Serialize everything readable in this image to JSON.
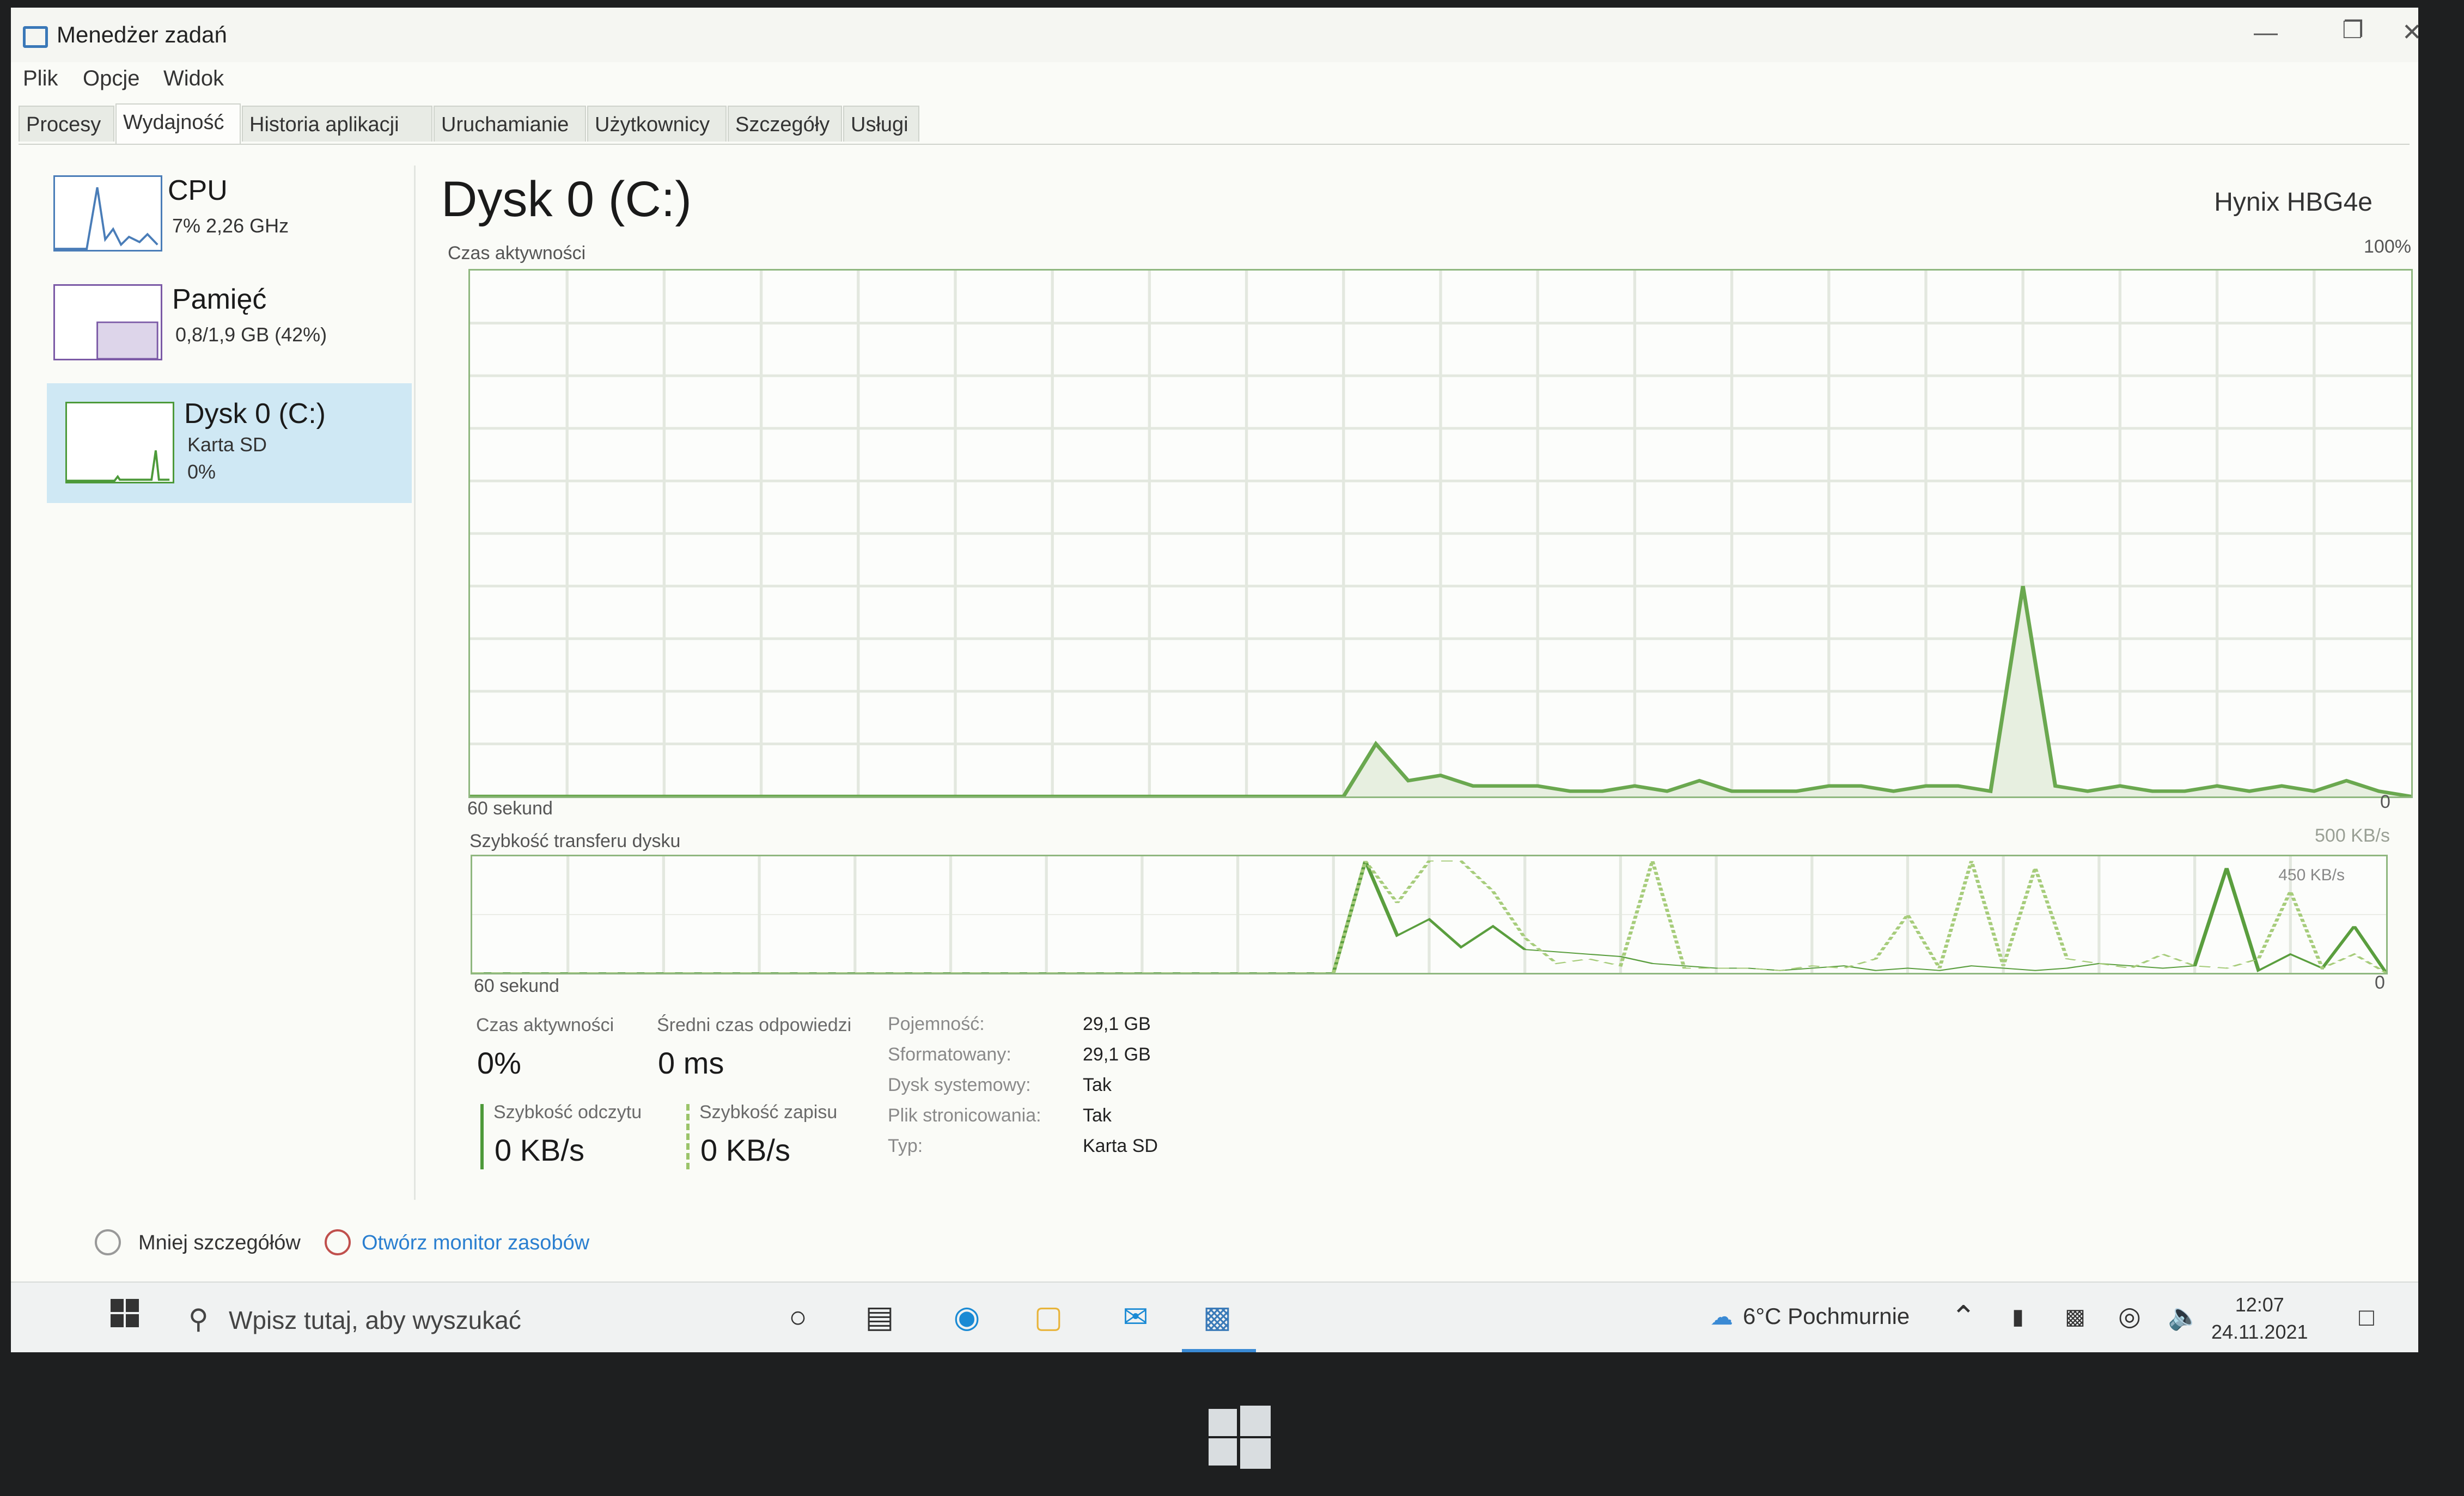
{
  "window": {
    "title": "Menedżer zadań",
    "minimize_icon": "minimize-icon",
    "restore_icon": "restore-icon",
    "close_icon": "close-icon"
  },
  "menu": [
    "Plik",
    "Opcje",
    "Widok"
  ],
  "tabs": [
    "Procesy",
    "Wydajność",
    "Historia aplikacji",
    "Uruchamianie",
    "Użytkownicy",
    "Szczegóły",
    "Usługi"
  ],
  "active_tab": "Wydajność",
  "sidebar": {
    "items": [
      {
        "title": "CPU",
        "line1": "7% 2,26 GHz",
        "line2": ""
      },
      {
        "title": "Pamięć",
        "line1": "0,8/1,9 GB (42%)",
        "line2": ""
      },
      {
        "title": "Dysk 0 (C:)",
        "line1": "Karta SD",
        "line2": "0%"
      }
    ]
  },
  "main": {
    "title": "Dysk 0 (C:)",
    "model": "Hynix HBG4e",
    "activity_chart": {
      "label": "Czas aktywności",
      "max": "100%",
      "min": "0",
      "time_label": "60 sekund"
    },
    "transfer_chart": {
      "label": "Szybkość transferu dysku",
      "max": "500 KB/s",
      "line_label": "450 KB/s",
      "min": "0",
      "time_label": "60 sekund"
    },
    "stats": {
      "active_time_label": "Czas aktywności",
      "active_time": "0%",
      "response_label": "Średni czas odpowiedzi",
      "response": "0 ms",
      "read_label": "Szybkość odczytu",
      "read": "0 KB/s",
      "write_label": "Szybkość zapisu",
      "write": "0 KB/s"
    },
    "properties": [
      {
        "label": "Pojemność:",
        "value": "29,1 GB"
      },
      {
        "label": "Sformatowany:",
        "value": "29,1 GB"
      },
      {
        "label": "Dysk systemowy:",
        "value": "Tak"
      },
      {
        "label": "Plik stronicowania:",
        "value": "Tak"
      },
      {
        "label": "Typ:",
        "value": "Karta SD"
      }
    ]
  },
  "footer": {
    "fewer_details": "Mniej szczegółów",
    "resource_monitor": "Otwórz monitor zasobów",
    "link_color": "#2a7fd0"
  },
  "taskbar": {
    "search_placeholder": "Wpisz tutaj, aby wyszukać",
    "weather": "6°C  Pochmurnie",
    "time": "12:07",
    "date": "24.11.2021"
  },
  "chart_data": [
    {
      "type": "area",
      "title": "Czas aktywności",
      "xlabel": "60 sekund",
      "ylim": [
        0,
        100
      ],
      "unit": "%",
      "x": [
        0,
        1,
        2,
        3,
        4,
        5,
        6,
        7,
        8,
        9,
        10,
        11,
        12,
        13,
        14,
        15,
        16,
        17,
        18,
        19,
        20,
        21,
        22,
        23,
        24,
        25,
        26,
        27,
        28,
        29,
        30,
        31,
        32,
        33,
        34,
        35,
        36,
        37,
        38,
        39,
        40,
        41,
        42,
        43,
        44,
        45,
        46,
        47,
        48,
        49,
        50,
        51,
        52,
        53,
        54,
        55,
        56,
        57,
        58,
        59,
        60
      ],
      "values": [
        0,
        0,
        0,
        0,
        0,
        0,
        0,
        0,
        0,
        0,
        0,
        0,
        0,
        0,
        0,
        0,
        0,
        0,
        0,
        0,
        0,
        0,
        0,
        0,
        0,
        0,
        0,
        0,
        10,
        3,
        4,
        2,
        2,
        2,
        1,
        1,
        2,
        1,
        3,
        1,
        1,
        1,
        2,
        2,
        1,
        2,
        2,
        1,
        40,
        2,
        1,
        2,
        1,
        1,
        2,
        1,
        2,
        1,
        3,
        1,
        0
      ]
    },
    {
      "type": "line",
      "title": "Szybkość transferu dysku",
      "xlabel": "60 sekund",
      "ylim": [
        0,
        500
      ],
      "unit": "KB/s",
      "x": [
        0,
        1,
        2,
        3,
        4,
        5,
        6,
        7,
        8,
        9,
        10,
        11,
        12,
        13,
        14,
        15,
        16,
        17,
        18,
        19,
        20,
        21,
        22,
        23,
        24,
        25,
        26,
        27,
        28,
        29,
        30,
        31,
        32,
        33,
        34,
        35,
        36,
        37,
        38,
        39,
        40,
        41,
        42,
        43,
        44,
        45,
        46,
        47,
        48,
        49,
        50,
        51,
        52,
        53,
        54,
        55,
        56,
        57,
        58,
        59,
        60
      ],
      "series": [
        {
          "values": [
            0,
            0,
            0,
            0,
            0,
            0,
            0,
            0,
            0,
            0,
            0,
            0,
            0,
            0,
            0,
            0,
            0,
            0,
            0,
            0,
            0,
            0,
            0,
            0,
            0,
            0,
            0,
            0,
            480,
            160,
            230,
            110,
            200,
            100,
            90,
            80,
            70,
            40,
            30,
            20,
            20,
            10,
            20,
            30,
            10,
            20,
            10,
            30,
            20,
            10,
            20,
            40,
            30,
            20,
            30,
            450,
            10,
            80,
            20,
            200,
            0
          ]
        },
        {
          "values": [
            0,
            0,
            0,
            0,
            0,
            0,
            0,
            0,
            0,
            0,
            0,
            0,
            0,
            0,
            0,
            0,
            0,
            0,
            0,
            0,
            0,
            0,
            0,
            0,
            0,
            0,
            0,
            0,
            480,
            300,
            480,
            480,
            350,
            150,
            40,
            60,
            30,
            480,
            20,
            20,
            20,
            10,
            30,
            20,
            60,
            250,
            20,
            480,
            30,
            450,
            60,
            40,
            20,
            80,
            30,
            20,
            60,
            350,
            20,
            80,
            0
          ]
        }
      ]
    }
  ]
}
